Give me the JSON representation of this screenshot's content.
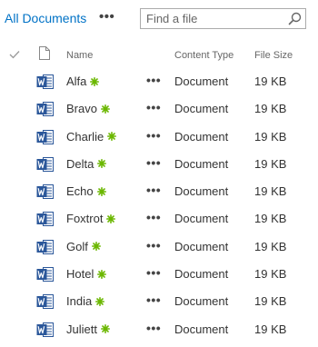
{
  "toolbar": {
    "view_label": "All Documents",
    "more_label": "•••",
    "search": {
      "placeholder": "Find a file",
      "value": ""
    }
  },
  "header": {
    "name": "Name",
    "content_type": "Content Type",
    "file_size": "File Size"
  },
  "colors": {
    "link": "#0072c6",
    "word_icon": "#2b579a",
    "new_badge": "#6bb700"
  },
  "rows": [
    {
      "name": "Alfa",
      "content_type": "Document",
      "file_size": "19 KB",
      "icon": "word-doc-icon",
      "is_new": true
    },
    {
      "name": "Bravo",
      "content_type": "Document",
      "file_size": "19 KB",
      "icon": "word-doc-icon",
      "is_new": true
    },
    {
      "name": "Charlie",
      "content_type": "Document",
      "file_size": "19 KB",
      "icon": "word-doc-icon",
      "is_new": true
    },
    {
      "name": "Delta",
      "content_type": "Document",
      "file_size": "19 KB",
      "icon": "word-doc-icon",
      "is_new": true
    },
    {
      "name": "Echo",
      "content_type": "Document",
      "file_size": "19 KB",
      "icon": "word-doc-icon",
      "is_new": true
    },
    {
      "name": "Foxtrot",
      "content_type": "Document",
      "file_size": "19 KB",
      "icon": "word-doc-icon",
      "is_new": true
    },
    {
      "name": "Golf",
      "content_type": "Document",
      "file_size": "19 KB",
      "icon": "word-doc-icon",
      "is_new": true
    },
    {
      "name": "Hotel",
      "content_type": "Document",
      "file_size": "19 KB",
      "icon": "word-doc-icon",
      "is_new": true
    },
    {
      "name": "India",
      "content_type": "Document",
      "file_size": "19 KB",
      "icon": "word-doc-icon",
      "is_new": true
    },
    {
      "name": "Juliett",
      "content_type": "Document",
      "file_size": "19 KB",
      "icon": "word-doc-icon",
      "is_new": true
    }
  ],
  "row_more_label": "•••"
}
